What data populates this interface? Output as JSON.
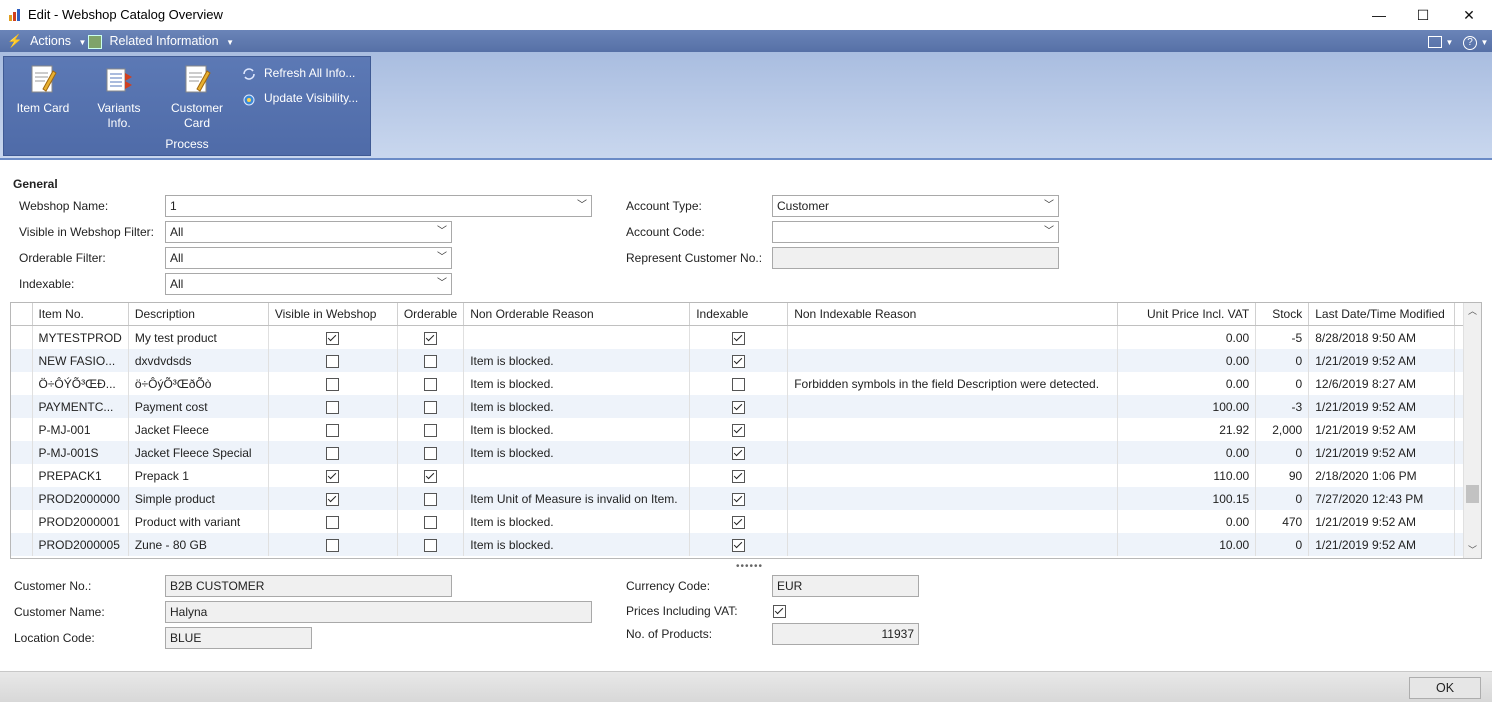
{
  "window": {
    "title": "Edit - Webshop Catalog Overview",
    "minimize": "—",
    "maximize": "☐",
    "close": "✕"
  },
  "menu": {
    "actions": "Actions",
    "related": "Related Information"
  },
  "ribbon": {
    "item_card": "Item Card",
    "variants_info_1": "Variants",
    "variants_info_2": "Info.",
    "customer_card_1": "Customer",
    "customer_card_2": "Card",
    "refresh": "Refresh All Info...",
    "update": "Update Visibility...",
    "group_label": "Process"
  },
  "general": {
    "title": "General",
    "webshop_name_label": "Webshop Name:",
    "webshop_name": "1",
    "visible_filter_label": "Visible in Webshop Filter:",
    "visible_filter": "All",
    "orderable_filter_label": "Orderable Filter:",
    "orderable_filter": "All",
    "indexable_label": "Indexable:",
    "indexable": "All",
    "account_type_label": "Account Type:",
    "account_type": "Customer",
    "account_code_label": "Account Code:",
    "account_code": "",
    "represent_label": "Represent Customer No.:",
    "represent": ""
  },
  "grid": {
    "headers": [
      "Item No.",
      "Description",
      "Visible in Webshop",
      "Orderable",
      "Non Orderable Reason",
      "Indexable",
      "Non Indexable Reason",
      "Unit Price Incl. VAT",
      "Stock",
      "Last Date/Time Modified"
    ],
    "rows": [
      {
        "no": "MYTESTPROD",
        "desc": "My test product",
        "visible": true,
        "orderable": true,
        "nor": "",
        "indexable": true,
        "nir": "",
        "price": "0.00",
        "stock": "-5",
        "modified": "8/28/2018 9:50 AM"
      },
      {
        "no": "NEW FASIO...",
        "desc": "dxvdvdsds",
        "visible": false,
        "orderable": false,
        "nor": "Item is blocked.",
        "indexable": true,
        "nir": "",
        "price": "0.00",
        "stock": "0",
        "modified": "1/21/2019 9:52 AM"
      },
      {
        "no": "Ö÷ÔÝÕ³ŒÐ...",
        "desc": "ö÷ÔýÕ³ŒðÕò",
        "visible": false,
        "orderable": false,
        "nor": "Item is blocked.",
        "indexable": false,
        "nir": "Forbidden symbols in the field Description were detected.",
        "price": "0.00",
        "stock": "0",
        "modified": "12/6/2019 8:27 AM"
      },
      {
        "no": "PAYMENTC...",
        "desc": "Payment cost",
        "visible": false,
        "orderable": false,
        "nor": "Item is blocked.",
        "indexable": true,
        "nir": "",
        "price": "100.00",
        "stock": "-3",
        "modified": "1/21/2019 9:52 AM"
      },
      {
        "no": "P-MJ-001",
        "desc": "Jacket Fleece",
        "visible": false,
        "orderable": false,
        "nor": "Item is blocked.",
        "indexable": true,
        "nir": "",
        "price": "21.92",
        "stock": "2,000",
        "modified": "1/21/2019 9:52 AM"
      },
      {
        "no": "P-MJ-001S",
        "desc": "Jacket Fleece Special",
        "visible": false,
        "orderable": false,
        "nor": "Item is blocked.",
        "indexable": true,
        "nir": "",
        "price": "0.00",
        "stock": "0",
        "modified": "1/21/2019 9:52 AM"
      },
      {
        "no": "PREPACK1",
        "desc": "Prepack 1",
        "visible": true,
        "orderable": true,
        "nor": "",
        "indexable": true,
        "nir": "",
        "price": "110.00",
        "stock": "90",
        "modified": "2/18/2020 1:06 PM"
      },
      {
        "no": "PROD2000000",
        "desc": "Simple product",
        "visible": true,
        "orderable": false,
        "nor": "Item Unit of Measure is invalid on Item.",
        "indexable": true,
        "nir": "",
        "price": "100.15",
        "stock": "0",
        "modified": "7/27/2020 12:43 PM"
      },
      {
        "no": "PROD2000001",
        "desc": "Product with variant",
        "visible": false,
        "orderable": false,
        "nor": "Item is blocked.",
        "indexable": true,
        "nir": "",
        "price": "0.00",
        "stock": "470",
        "modified": "1/21/2019 9:52 AM"
      },
      {
        "no": "PROD2000005",
        "desc": "Zune - 80 GB",
        "visible": false,
        "orderable": false,
        "nor": "Item is blocked.",
        "indexable": true,
        "nir": "",
        "price": "10.00",
        "stock": "0",
        "modified": "1/21/2019 9:52 AM"
      }
    ]
  },
  "details": {
    "customer_no_label": "Customer No.:",
    "customer_no": "B2B CUSTOMER",
    "customer_name_label": "Customer Name:",
    "customer_name": "Halyna",
    "location_label": "Location Code:",
    "location": "BLUE",
    "currency_label": "Currency Code:",
    "currency": "EUR",
    "prices_vat_label": "Prices Including VAT:",
    "prices_vat": true,
    "products_label": "No. of Products:",
    "products": "11937"
  },
  "footer": {
    "ok": "OK"
  },
  "colors": {
    "ribbon_group": "#5c79b5",
    "menubar": "#6a84b8",
    "alt_row": "#eef3fa"
  }
}
